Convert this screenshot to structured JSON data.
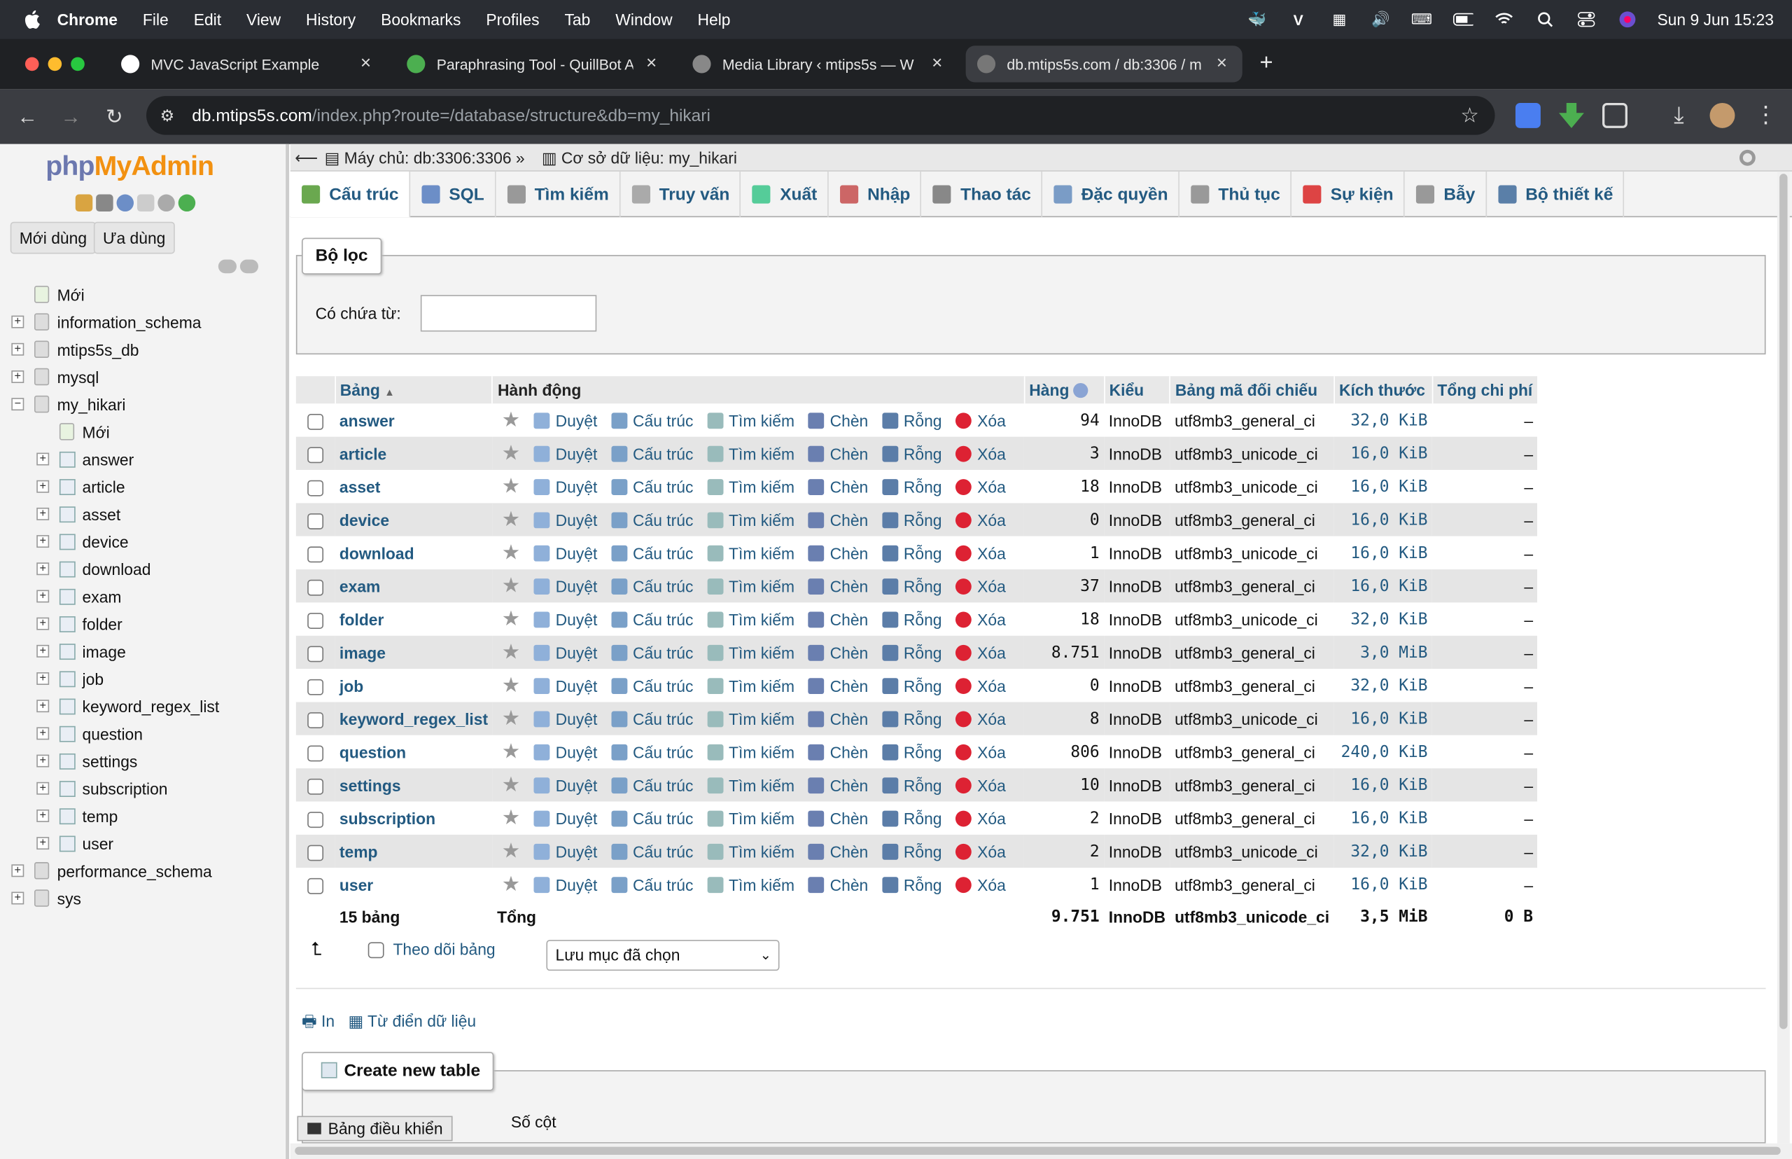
{
  "menubar": {
    "app": "Chrome",
    "items": [
      "File",
      "Edit",
      "View",
      "History",
      "Bookmarks",
      "Profiles",
      "Tab",
      "Window",
      "Help"
    ],
    "clock": "Sun 9 Jun  15:23"
  },
  "browser": {
    "tabs": [
      {
        "title": "MVC JavaScript Example"
      },
      {
        "title": "Paraphrasing Tool - QuillBot A"
      },
      {
        "title": "Media Library ‹ mtips5s — W"
      },
      {
        "title": "db.mtips5s.com / db:3306 / m"
      }
    ],
    "url_host": "db.mtips5s.com",
    "url_path": "/index.php?route=/database/structure&db=my_hikari"
  },
  "sidebar": {
    "logo_php": "php",
    "logo_ma": "MyAdmin",
    "recent_btn": "Mới dùng",
    "fav_btn": "Ưa dùng",
    "new_item": "Mới",
    "databases_before": [
      "information_schema",
      "mtips5s_db",
      "mysql"
    ],
    "current_db": "my_hikari",
    "db_new": "Mới",
    "tables": [
      "answer",
      "article",
      "asset",
      "device",
      "download",
      "exam",
      "folder",
      "image",
      "job",
      "keyword_regex_list",
      "question",
      "settings",
      "subscription",
      "temp",
      "user"
    ],
    "databases_after": [
      "performance_schema",
      "sys"
    ]
  },
  "breadcrumb": {
    "server": "Máy chủ: db:3306:3306",
    "database": "Cơ sở dữ liệu: my_hikari"
  },
  "tabs": [
    "Cấu trúc",
    "SQL",
    "Tìm kiếm",
    "Truy vấn",
    "Xuất",
    "Nhập",
    "Thao tác",
    "Đặc quyền",
    "Thủ tục",
    "Sự kiện",
    "Bẫy",
    "Bộ thiết kế"
  ],
  "filter": {
    "legend": "Bộ lọc",
    "label": "Có chứa từ:",
    "value": ""
  },
  "table": {
    "headers": {
      "name": "Bảng",
      "action": "Hành động",
      "rows": "Hàng",
      "type": "Kiểu",
      "collation": "Bảng mã đối chiếu",
      "size": "Kích thước",
      "overhead": "Tổng chi phí"
    },
    "actions": {
      "browse": "Duyệt",
      "structure": "Cấu trúc",
      "search": "Tìm kiếm",
      "insert": "Chèn",
      "empty": "Rỗng",
      "drop": "Xóa"
    },
    "rows": [
      {
        "name": "answer",
        "rows": "94",
        "type": "InnoDB",
        "collation": "utf8mb3_general_ci",
        "size": "32,0 KiB",
        "overhead": "–"
      },
      {
        "name": "article",
        "rows": "3",
        "type": "InnoDB",
        "collation": "utf8mb3_unicode_ci",
        "size": "16,0 KiB",
        "overhead": "–"
      },
      {
        "name": "asset",
        "rows": "18",
        "type": "InnoDB",
        "collation": "utf8mb3_unicode_ci",
        "size": "16,0 KiB",
        "overhead": "–"
      },
      {
        "name": "device",
        "rows": "0",
        "type": "InnoDB",
        "collation": "utf8mb3_general_ci",
        "size": "16,0 KiB",
        "overhead": "–"
      },
      {
        "name": "download",
        "rows": "1",
        "type": "InnoDB",
        "collation": "utf8mb3_unicode_ci",
        "size": "16,0 KiB",
        "overhead": "–"
      },
      {
        "name": "exam",
        "rows": "37",
        "type": "InnoDB",
        "collation": "utf8mb3_general_ci",
        "size": "16,0 KiB",
        "overhead": "–"
      },
      {
        "name": "folder",
        "rows": "18",
        "type": "InnoDB",
        "collation": "utf8mb3_unicode_ci",
        "size": "32,0 KiB",
        "overhead": "–"
      },
      {
        "name": "image",
        "rows": "8.751",
        "type": "InnoDB",
        "collation": "utf8mb3_general_ci",
        "size": "3,0 MiB",
        "overhead": "–"
      },
      {
        "name": "job",
        "rows": "0",
        "type": "InnoDB",
        "collation": "utf8mb3_general_ci",
        "size": "32,0 KiB",
        "overhead": "–"
      },
      {
        "name": "keyword_regex_list",
        "rows": "8",
        "type": "InnoDB",
        "collation": "utf8mb3_unicode_ci",
        "size": "16,0 KiB",
        "overhead": "–"
      },
      {
        "name": "question",
        "rows": "806",
        "type": "InnoDB",
        "collation": "utf8mb3_general_ci",
        "size": "240,0 KiB",
        "overhead": "–"
      },
      {
        "name": "settings",
        "rows": "10",
        "type": "InnoDB",
        "collation": "utf8mb3_general_ci",
        "size": "16,0 KiB",
        "overhead": "–"
      },
      {
        "name": "subscription",
        "rows": "2",
        "type": "InnoDB",
        "collation": "utf8mb3_general_ci",
        "size": "16,0 KiB",
        "overhead": "–"
      },
      {
        "name": "temp",
        "rows": "2",
        "type": "InnoDB",
        "collation": "utf8mb3_unicode_ci",
        "size": "32,0 KiB",
        "overhead": "–"
      },
      {
        "name": "user",
        "rows": "1",
        "type": "InnoDB",
        "collation": "utf8mb3_general_ci",
        "size": "16,0 KiB",
        "overhead": "–"
      }
    ],
    "footer": {
      "count": "15 bảng",
      "label": "Tổng",
      "rows": "9.751",
      "type": "InnoDB",
      "collation": "utf8mb3_unicode_ci",
      "size": "3,5 MiB",
      "overhead": "0 B"
    }
  },
  "bulk": {
    "track_label": "Theo dõi bảng",
    "select_value": "Lưu mục đã chọn"
  },
  "links": {
    "print": "In",
    "dictionary": "Từ điển dữ liệu"
  },
  "create": {
    "legend": "Create new table",
    "columns_label": "Số cột"
  },
  "console": "Bảng điều khiển"
}
